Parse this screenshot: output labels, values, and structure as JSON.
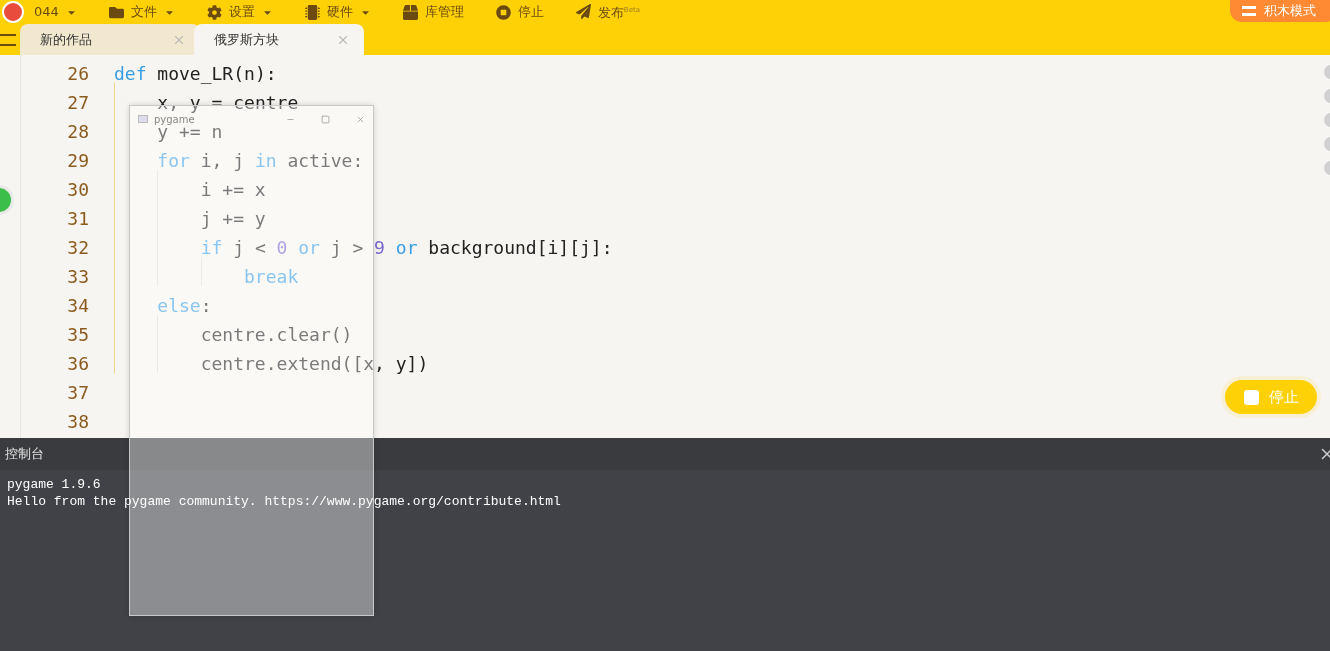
{
  "menu": {
    "project": "044",
    "items": [
      {
        "label": "文件",
        "dropdown": true
      },
      {
        "label": "设置",
        "dropdown": true
      },
      {
        "label": "硬件",
        "dropdown": true
      },
      {
        "label": "库管理",
        "dropdown": false
      },
      {
        "label": "停止",
        "dropdown": false
      },
      {
        "label": "发布$^{Beta}$",
        "dropdown": false
      }
    ],
    "mode_button": "积木模式"
  },
  "tabs": [
    {
      "label": "新的作品",
      "selected": false
    },
    {
      "label": "俄罗斯方块",
      "selected": true
    }
  ],
  "editor": {
    "lines": [
      {
        "number": "26",
        "tokens": [
          {
            "text": "def",
            "kind": "keyword"
          },
          {
            "text": " move_LR(n):",
            "kind": "plain"
          }
        ],
        "children": [
          {
            "number": "27",
            "tokens": [
              {
                "text": "x, y = centre",
                "kind": "plain"
              }
            ]
          },
          {
            "number": "28",
            "tokens": [
              {
                "text": "y += n",
                "kind": "plain"
              }
            ]
          },
          {
            "number": "29",
            "tokens": [
              {
                "text": "for",
                "kind": "keyword"
              },
              {
                "text": " i, j ",
                "kind": "plain"
              },
              {
                "text": "in",
                "kind": "keyword"
              },
              {
                "text": " active:",
                "kind": "plain"
              }
            ],
            "children": [
              {
                "number": "30",
                "tokens": [
                  {
                    "text": "i += x",
                    "kind": "plain"
                  }
                ]
              },
              {
                "number": "31",
                "tokens": [
                  {
                    "text": "j += y",
                    "kind": "plain"
                  }
                ]
              },
              {
                "number": "32",
                "tokens": [
                  {
                    "text": "if",
                    "kind": "keyword"
                  },
                  {
                    "text": " j < ",
                    "kind": "plain"
                  },
                  {
                    "text": "0",
                    "kind": "number"
                  },
                  {
                    "text": " or",
                    "kind": "keyword"
                  },
                  {
                    "text": " j > ",
                    "kind": "plain"
                  },
                  {
                    "text": "9",
                    "kind": "number"
                  },
                  {
                    "text": " or",
                    "kind": "keyword"
                  },
                  {
                    "text": " background[i][j]:",
                    "kind": "plain"
                  }
                ],
                "children": [
                  {
                    "number": "33",
                    "tokens": [
                      {
                        "text": "break",
                        "kind": "keyword"
                      }
                    ]
                  }
                ]
              }
            ]
          },
          {
            "number": "34",
            "tokens": [
              {
                "text": "else",
                "kind": "keyword"
              },
              {
                "text": ":",
                "kind": "plain"
              }
            ],
            "children": [
              {
                "number": "35",
                "tokens": [
                  {
                    "text": "centre.clear()",
                    "kind": "plain"
                  }
                ]
              },
              {
                "number": "36",
                "tokens": [
                  {
                    "text": "centre.extend([x, y])",
                    "kind": "plain"
                  }
                ]
              }
            ]
          }
        ]
      },
      {
        "number": "37"
      },
      {
        "number": "38"
      }
    ]
  },
  "stop_button": "停止",
  "console": {
    "title": "控制台",
    "lines": [
      "pygame 1.9.6",
      "Hello from the pygame community. https://www.pygame.org/contribute.html"
    ]
  },
  "pygame_window": {
    "title": "pygame"
  }
}
